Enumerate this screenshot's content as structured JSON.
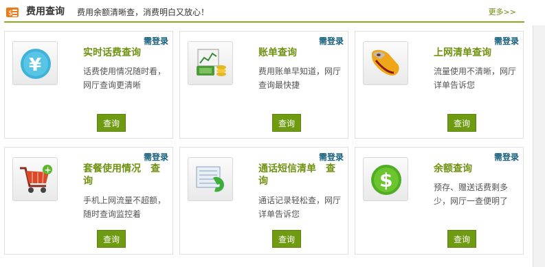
{
  "header": {
    "title": "费用查询",
    "subtitle": "费用余额清晰查，消费明白又放心！",
    "more": "更多>>"
  },
  "cards": [
    {
      "login": "需登录",
      "icon": "yen-coin-icon",
      "title": "实时话费查询",
      "desc": "话费使用情况随时看，网厅查询更清晰",
      "button": "查询"
    },
    {
      "login": "需登录",
      "icon": "bill-money-icon",
      "title": "账单查询",
      "desc": "费用账单早知道，网厅查询最快捷",
      "button": "查询"
    },
    {
      "login": "需登录",
      "icon": "mouse-icon",
      "title": "上网清单查询",
      "desc": "流量使用不清晰，网厅详单告诉您",
      "button": "查询"
    },
    {
      "login": "需登录",
      "icon": "shopping-cart-icon",
      "title": "套餐使用情况　查询",
      "desc": "手机上网流量不超额，随时查询监控着",
      "button": "查询"
    },
    {
      "login": "需登录",
      "icon": "phone-records-icon",
      "title": "通话短信清单　查询",
      "desc": "通话记录轻松查，网厅详单告诉您",
      "button": "查询"
    },
    {
      "login": "需登录",
      "icon": "dollar-coin-icon",
      "title": "余额查询",
      "desc": "预存、赠送话费剩多少，网厅一查便明了",
      "button": "查询"
    }
  ]
}
